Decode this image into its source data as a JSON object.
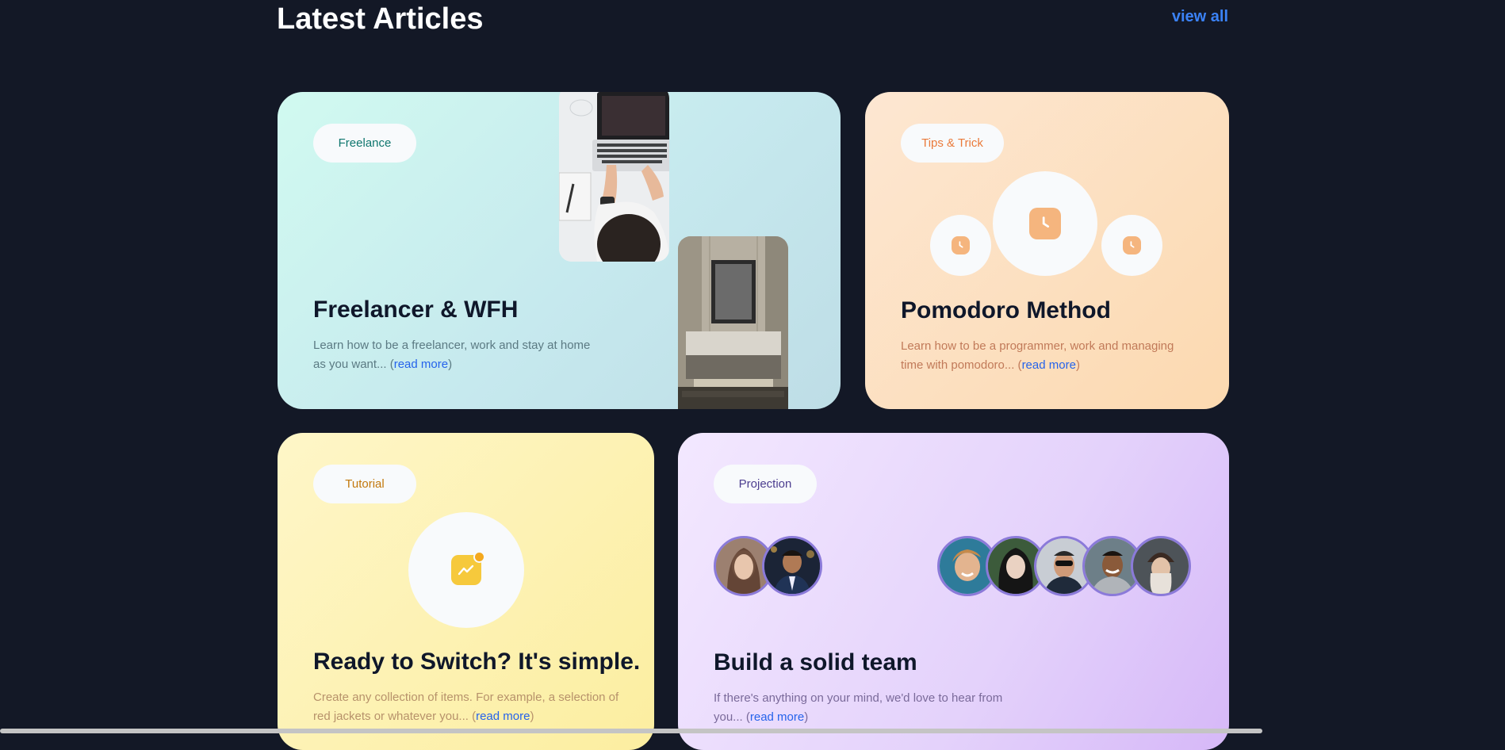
{
  "header": {
    "title": "Latest Articles",
    "view_all": "view all"
  },
  "cards": [
    {
      "tag": "Freelance",
      "title": "Freelancer & WFH",
      "desc": "Learn how to be a freelancer, work and stay at home as you want... (",
      "read_more": "read more",
      "desc_end": ")"
    },
    {
      "tag": "Tips & Trick",
      "title": "Pomodoro Method",
      "desc": "Learn how to be a programmer, work and managing time with pomodoro... (",
      "read_more": "read more",
      "desc_end": ")"
    },
    {
      "tag": "Tutorial",
      "title": "Ready to Switch? It's simple.",
      "desc": "Create any collection of items. For example, a selection of red jackets or whatever you... (",
      "read_more": "read more",
      "desc_end": ")"
    },
    {
      "tag": "Projection",
      "title": "Build a solid team",
      "desc": "If there's anything on your mind, we'd love to hear from you... (",
      "read_more": "read more",
      "desc_end": ")"
    }
  ],
  "colors": {
    "accent": "#3b82f6",
    "freelance_tag": "#0f766e",
    "tips_tag": "#ea7a3a",
    "tutorial_tag": "#c2780c",
    "projection_tag": "#4c3d8f"
  },
  "icons": {
    "clock": "clock-icon",
    "chart": "chart-icon"
  }
}
